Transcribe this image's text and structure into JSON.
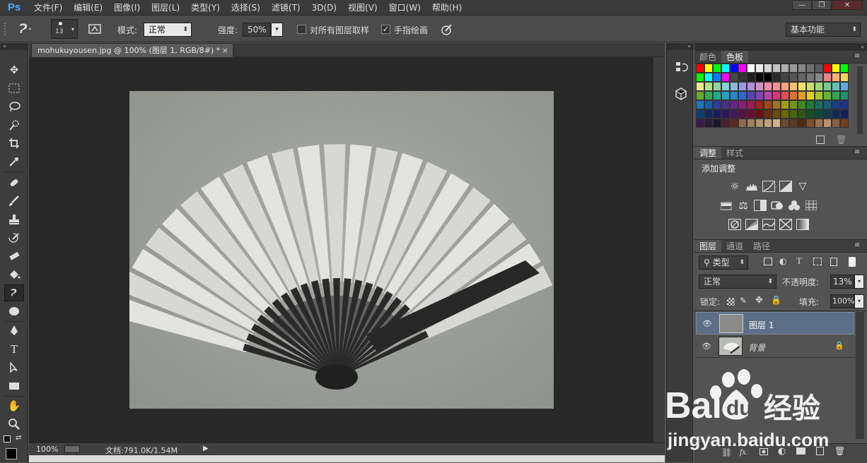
{
  "app": {
    "logo": "Ps"
  },
  "menu": [
    "文件(F)",
    "编辑(E)",
    "图像(I)",
    "图层(L)",
    "类型(Y)",
    "选择(S)",
    "滤镜(T)",
    "3D(D)",
    "视图(V)",
    "窗口(W)",
    "帮助(H)"
  ],
  "window_controls": {
    "minimize": "—",
    "restore": "❐",
    "close": "✕"
  },
  "options": {
    "brush_size": "13",
    "mode_label": "模式:",
    "mode_value": "正常",
    "strength_label": "强度:",
    "strength_value": "50%",
    "sample_all_label": "对所有图层取样",
    "sample_all_checked": false,
    "finger_paint_label": "手指绘画",
    "finger_paint_checked": true,
    "workspace": "基本功能"
  },
  "document": {
    "tab_title": "mohukuyousen.jpg @ 100% (图层 1, RGB/8#) *",
    "zoom": "100%",
    "doc_info": "文档:791.0K/1.54M"
  },
  "panels": {
    "color_tabs": [
      "颜色",
      "色板"
    ],
    "adjust_tabs": [
      "调整",
      "样式"
    ],
    "adjust_title": "添加调整",
    "layers_tabs": [
      "图层",
      "通道",
      "路径"
    ],
    "filter_kind": "类型",
    "blend_mode": "正常",
    "opacity_label": "不透明度:",
    "opacity_value": "13%",
    "lock_label": "锁定:",
    "fill_label": "填充:",
    "fill_value": "100%",
    "layers": [
      {
        "name": "图层 1",
        "selected": true,
        "locked": false
      },
      {
        "name": "背景",
        "selected": false,
        "locked": true
      }
    ]
  },
  "swatch_colors": [
    "#ff0000",
    "#ffff00",
    "#00ff00",
    "#00ffff",
    "#0000ff",
    "#ff00ff",
    "#ffffff",
    "#ebebeb",
    "#d6d6d6",
    "#c2c2c2",
    "#adadad",
    "#999999",
    "#858585",
    "#707070",
    "#5c5c5c",
    "#ff0000",
    "#ffff00",
    "#00ff00",
    "#00ff00",
    "#00ffff",
    "#0080ff",
    "#ff00ff",
    "#474747",
    "#333333",
    "#1f1f1f",
    "#0a0a0a",
    "#000000",
    "#2a2a2a",
    "#444",
    "#555",
    "#666",
    "#777",
    "#888",
    "#f08080",
    "#ffb070",
    "#f5d36b",
    "#f0e68c",
    "#b5e08a",
    "#8fd6a3",
    "#82d0d0",
    "#8ab8e0",
    "#9a9ae0",
    "#b28fd6",
    "#d68fc6",
    "#f08ca8",
    "#f29090",
    "#f6a37a",
    "#f6c26a",
    "#f2e06a",
    "#c9e06a",
    "#9cd67a",
    "#72c98e",
    "#62c0b8",
    "#62a8d6",
    "#66aa33",
    "#33aa55",
    "#22aa88",
    "#22a0c8",
    "#2288cc",
    "#3366cc",
    "#5544bb",
    "#8844bb",
    "#bb44aa",
    "#dd3377",
    "#e05050",
    "#e07030",
    "#e0a020",
    "#e0d020",
    "#a0c820",
    "#60b830",
    "#30a850",
    "#209070",
    "#1b75bb",
    "#1b5ca8",
    "#2a3f98",
    "#4a2e8a",
    "#6a2288",
    "#8a1f70",
    "#a01850",
    "#a02020",
    "#a04818",
    "#a07418",
    "#a09c18",
    "#6e9618",
    "#3e8a20",
    "#1e7a38",
    "#186e5a",
    "#185e78",
    "#183f88",
    "#22308a",
    "#0e3e6e",
    "#102a60",
    "#1a1a5a",
    "#301660",
    "#481560",
    "#5a1048",
    "#6a0e30",
    "#6a1010",
    "#6a2e0e",
    "#6a4c0e",
    "#6a660e",
    "#48620e",
    "#2a5a12",
    "#124e24",
    "#0e4a3a",
    "#0e3c4e",
    "#0e2a58",
    "#141e58",
    "#3a1a4a",
    "#2a1a3a",
    "#1a1a2a",
    "#4a2030",
    "#5a2a20",
    "#8a6a50",
    "#a08060",
    "#b09070",
    "#c0a080",
    "#d0b090",
    "#6a4a30",
    "#5a3a20",
    "#4a2a10",
    "#7a5030",
    "#9a7050",
    "#ba9070",
    "#8a6040",
    "#704020"
  ]
}
